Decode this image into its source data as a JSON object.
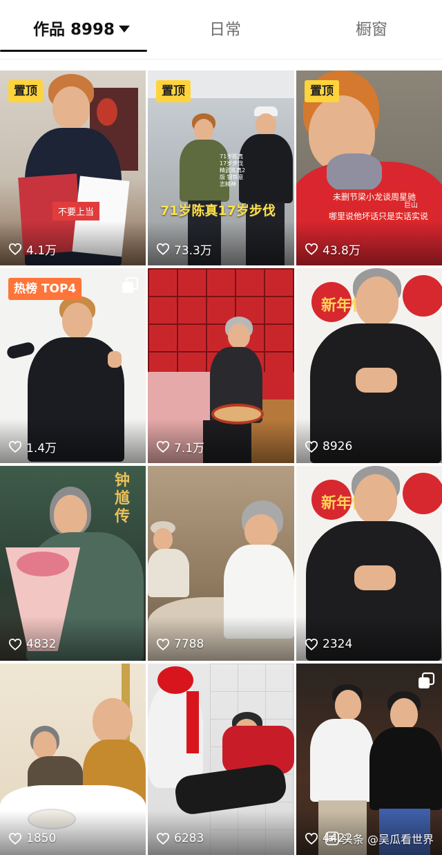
{
  "tabs": {
    "works": {
      "label": "作品",
      "count": "8998"
    },
    "daily": {
      "label": "日常"
    },
    "shop": {
      "label": "橱窗"
    }
  },
  "badges": {
    "pinned": "置顶",
    "hot": "热榜 TOP4"
  },
  "videos": [
    {
      "likes": "4.1万",
      "badge": "置顶",
      "overlay": "不要上当"
    },
    {
      "likes": "73.3万",
      "badge": "置顶",
      "overlay": "71岁陈真17岁步伐",
      "side_text": "71岁陈真 17岁步伐 精武陈真2版 钢铁意志精神"
    },
    {
      "likes": "43.8万",
      "badge": "置顶",
      "overlay": "未删节梁小龙谈周星驰",
      "overlay2": "哪里说他坏话只是实话实说",
      "tag": "巨山"
    },
    {
      "likes": "1.4万",
      "badge": "热榜 TOP4"
    },
    {
      "likes": "7.1万"
    },
    {
      "likes": "8926",
      "deco": "新年快乐"
    },
    {
      "likes": "4832",
      "deco": "钟馗传"
    },
    {
      "likes": "7788"
    },
    {
      "likes": "2324",
      "deco": "新年快乐"
    },
    {
      "likes": "1850"
    },
    {
      "likes": "6283"
    },
    {
      "likes": "4422"
    }
  ],
  "watermark": {
    "text": "头条 @吴瓜看世界"
  },
  "icons": {
    "heart": "heart-icon",
    "multi": "multi-photo-icon",
    "dropdown": "caret-down-icon"
  },
  "colors": {
    "pinned_badge": "#ffd43b",
    "hot_badge": "#ff7438",
    "tab_active": "#111111",
    "tab_inactive": "#6f6f6f"
  }
}
